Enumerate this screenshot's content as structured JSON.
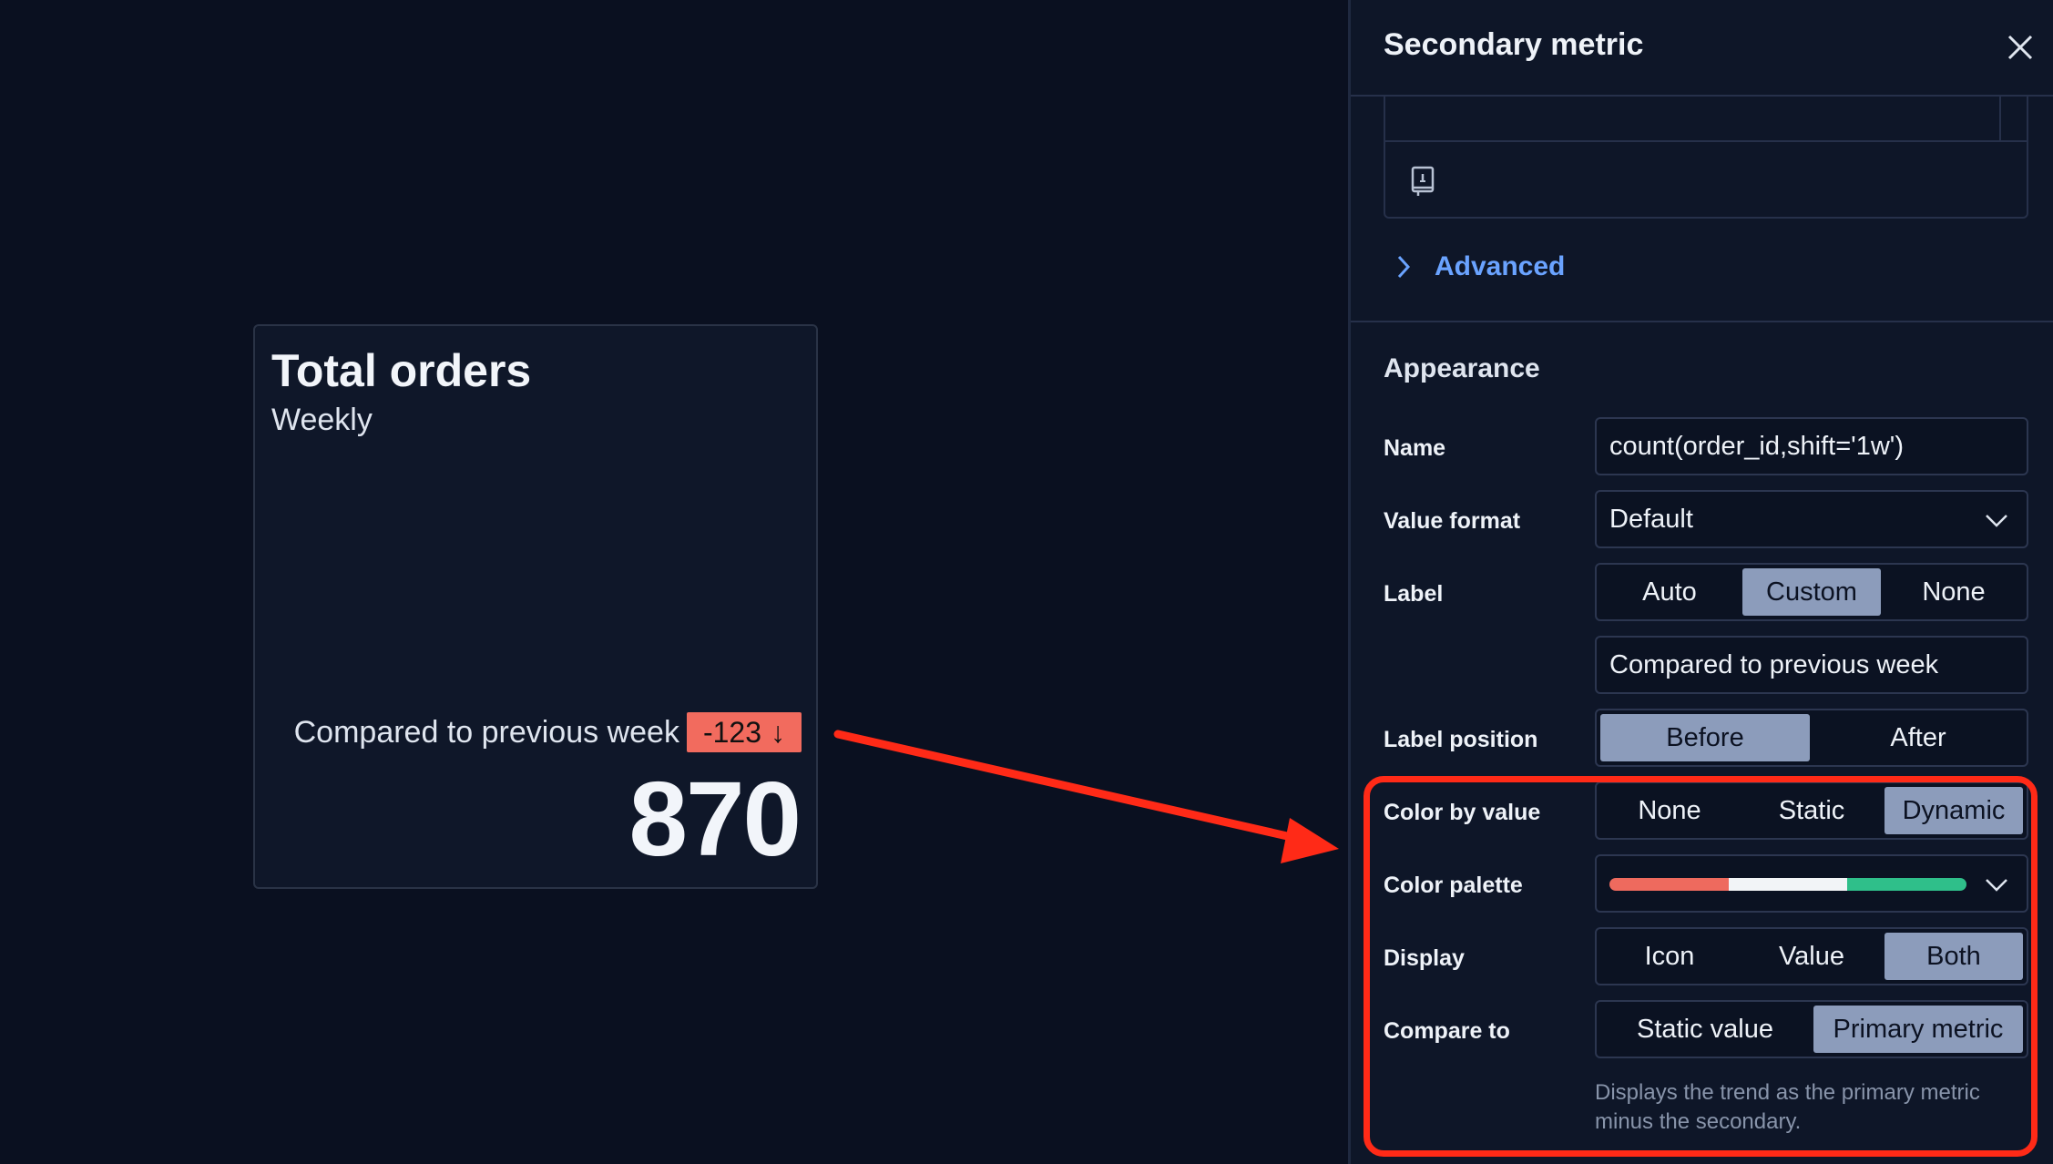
{
  "card": {
    "title": "Total orders",
    "subtitle": "Weekly",
    "compare_label": "Compared to previous week",
    "trend_value": "-123",
    "trend_arrow": "↓",
    "value": "870",
    "trend_color": "#f26b5e"
  },
  "flyout": {
    "title": "Secondary metric",
    "advanced_label": "Advanced",
    "appearance_title": "Appearance",
    "name": {
      "label": "Name",
      "value": "count(order_id,shift='1w')"
    },
    "value_format": {
      "label": "Value format",
      "value": "Default"
    },
    "label": {
      "label": "Label",
      "options": [
        "Auto",
        "Custom",
        "None"
      ],
      "selected": "Custom",
      "custom_value": "Compared to previous week"
    },
    "label_position": {
      "label": "Label position",
      "options": [
        "Before",
        "After"
      ],
      "selected": "Before"
    },
    "color_by_value": {
      "label": "Color by value",
      "options": [
        "None",
        "Static",
        "Dynamic"
      ],
      "selected": "Dynamic"
    },
    "color_palette": {
      "label": "Color palette",
      "colors": [
        "#ee6a5e",
        "#f2f4f7",
        "#2fbf8a"
      ]
    },
    "display": {
      "label": "Display",
      "options": [
        "Icon",
        "Value",
        "Both"
      ],
      "selected": "Both"
    },
    "compare_to": {
      "label": "Compare to",
      "options": [
        "Static value",
        "Primary metric"
      ],
      "selected": "Primary metric"
    },
    "help_text": "Displays the trend as the primary metric minus the secondary."
  },
  "icons": {
    "close": "close-icon",
    "docs": "book-icon",
    "advanced": "chevron-right-icon",
    "select": "chevron-down-icon"
  },
  "colors": {
    "accent_link": "#6aa3ff",
    "selected_segment": "#8c9cbb",
    "annotation": "#ff2a17"
  }
}
